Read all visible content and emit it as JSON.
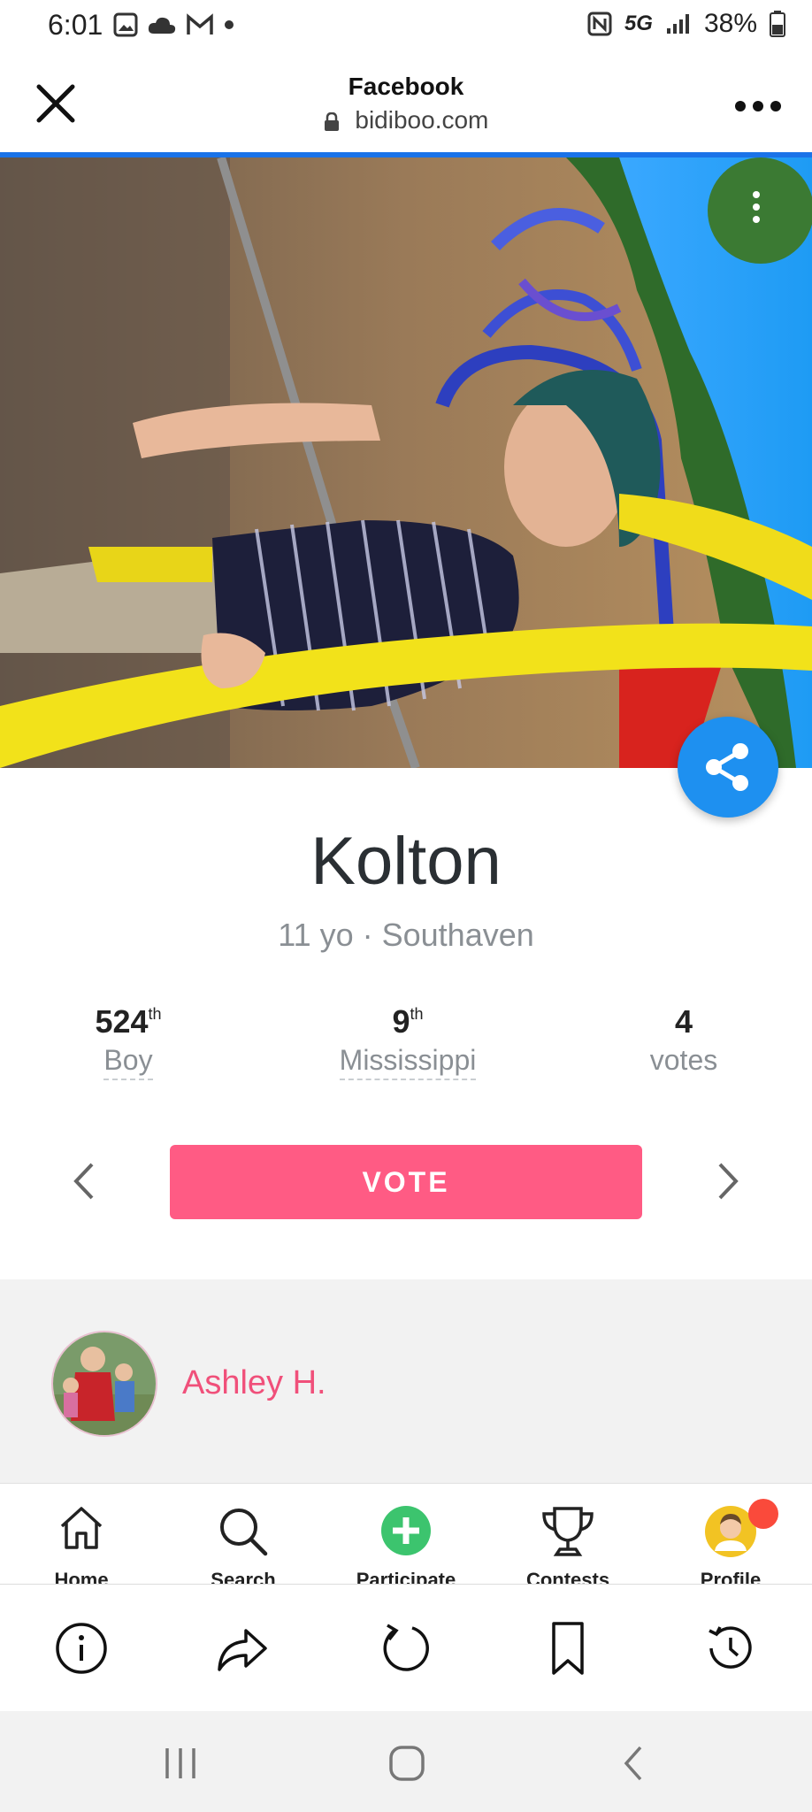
{
  "status_bar": {
    "time": "6:01",
    "battery": "38%",
    "network": "5G",
    "icons": [
      "gallery-icon",
      "cloud-icon",
      "gmail-icon",
      "dot-icon",
      "nfc-icon",
      "signal-icon",
      "battery-icon"
    ]
  },
  "browser_header": {
    "title": "Facebook",
    "url": "bidiboo.com",
    "close_icon": "close-icon",
    "more_icon": "more-icon"
  },
  "profile": {
    "name": "Kolton",
    "subtitle": "11 yo · Southaven"
  },
  "stats": [
    {
      "value": "524",
      "suffix": "th",
      "label": "Boy"
    },
    {
      "value": "9",
      "suffix": "th",
      "label": "Mississippi"
    },
    {
      "value": "4",
      "suffix": "",
      "label": "votes"
    }
  ],
  "vote_label": "VOTE",
  "owner": {
    "name": "Ashley H."
  },
  "app_nav": {
    "items": [
      {
        "label": "Home",
        "icon": "home-icon"
      },
      {
        "label": "Search",
        "icon": "search-icon"
      },
      {
        "label": "Participate",
        "icon": "plus-icon"
      },
      {
        "label": "Contests",
        "icon": "trophy-icon"
      },
      {
        "label": "Profile",
        "icon": "profile-icon"
      }
    ]
  },
  "browser_toolbar": [
    "info-icon",
    "share-forward-icon",
    "reload-icon",
    "bookmark-icon",
    "history-icon"
  ],
  "system_nav": [
    "recents-icon",
    "home-button-icon",
    "back-icon"
  ],
  "colors": {
    "accent": "#ff5b84",
    "share": "#1e90f0",
    "progress": "#1a73e8",
    "owner_name": "#f0507a"
  }
}
